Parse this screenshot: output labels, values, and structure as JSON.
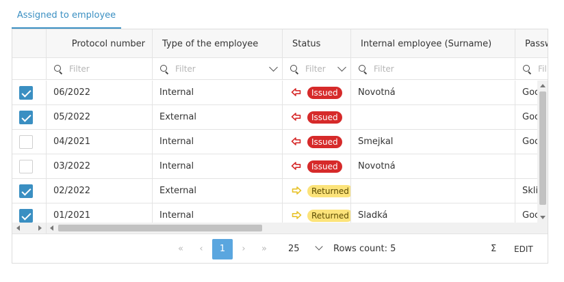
{
  "tab": {
    "label": "Assigned to employee"
  },
  "columns": {
    "protocol": "Protocol number",
    "type": "Type of the employee",
    "status": "Status",
    "surname": "Internal employee (Surname)",
    "password": "Passw"
  },
  "filters": {
    "protocol_placeholder": "Filter",
    "type_placeholder": "Filter",
    "status_placeholder": "Filter",
    "surname_placeholder": "Filter",
    "password_placeholder": "Fil"
  },
  "rows": [
    {
      "checked": true,
      "protocol": "06/2022",
      "type": "Internal",
      "status": "Issued",
      "surname": "Novotná",
      "password": "Goo"
    },
    {
      "checked": true,
      "protocol": "05/2022",
      "type": "External",
      "status": "Issued",
      "surname": "",
      "password": "Goo"
    },
    {
      "checked": false,
      "protocol": "04/2021",
      "type": "Internal",
      "status": "Issued",
      "surname": "Smejkal",
      "password": "Goo"
    },
    {
      "checked": false,
      "protocol": "03/2022",
      "type": "Internal",
      "status": "Issued",
      "surname": "Novotná",
      "password": ""
    },
    {
      "checked": true,
      "protocol": "02/2022",
      "type": "External",
      "status": "Returned",
      "surname": "",
      "password": "Skli"
    },
    {
      "checked": true,
      "protocol": "01/2021",
      "type": "Internal",
      "status": "Returned",
      "surname": "Sladká",
      "password": "Goo"
    }
  ],
  "colors": {
    "accent": "#3a8fc2",
    "issued": "#d62a2a",
    "returned": "#fce37a",
    "issued_arrow": "#d62a2a",
    "returned_arrow": "#e8c22a"
  },
  "footer": {
    "first": "«",
    "prev": "‹",
    "current_page": "1",
    "next": "›",
    "last": "»",
    "page_size": "25",
    "rows_count": "Rows count: 5",
    "sum": "Σ",
    "edit": "EDIT"
  }
}
